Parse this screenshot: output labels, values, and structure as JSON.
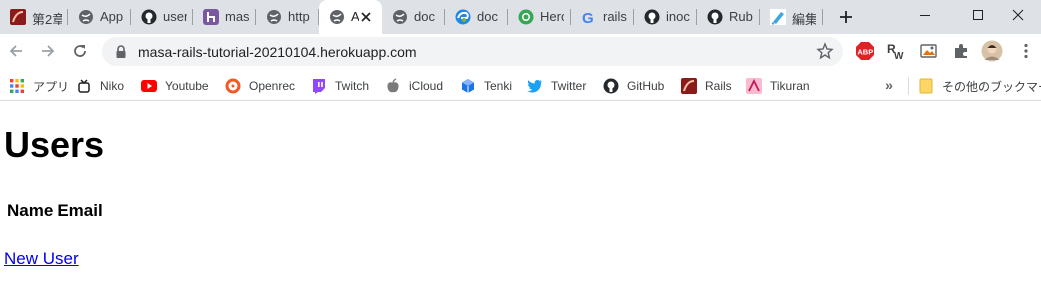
{
  "browser": {
    "tabs": [
      {
        "title": "第2章",
        "icon": "rails-logo-icon"
      },
      {
        "title": "App",
        "icon": "globe-icon"
      },
      {
        "title": "user",
        "icon": "github-icon"
      },
      {
        "title": "mas",
        "icon": "heroku-icon"
      },
      {
        "title": "http",
        "icon": "globe-icon"
      },
      {
        "title": "A",
        "icon": "globe-icon"
      },
      {
        "title": "doc",
        "icon": "globe-icon"
      },
      {
        "title": "doc",
        "icon": "edge-icon"
      },
      {
        "title": "Hero",
        "icon": "green-circle-icon"
      },
      {
        "title": "rails",
        "icon": "google-icon"
      },
      {
        "title": "inoc",
        "icon": "github-icon"
      },
      {
        "title": "Rub",
        "icon": "github-icon"
      },
      {
        "title": "編集",
        "icon": "pencil-icon"
      }
    ],
    "active_tab_index": 5,
    "url": "masa-rails-tutorial-20210104.herokuapp.com",
    "bookmarks": [
      {
        "label": "アプリ",
        "icon": "apps-grid-icon"
      },
      {
        "label": "Niko",
        "icon": "niko-icon"
      },
      {
        "label": "Youtube",
        "icon": "youtube-icon"
      },
      {
        "label": "Openrec",
        "icon": "openrec-icon"
      },
      {
        "label": "Twitch",
        "icon": "twitch-icon"
      },
      {
        "label": "iCloud",
        "icon": "apple-icon"
      },
      {
        "label": "Tenki",
        "icon": "tenki-icon"
      },
      {
        "label": "Twitter",
        "icon": "twitter-icon"
      },
      {
        "label": "GitHub",
        "icon": "github-icon"
      },
      {
        "label": "Rails",
        "icon": "rails-logo-icon"
      },
      {
        "label": "Tikuran",
        "icon": "tikuran-icon"
      }
    ],
    "more_bookmarks_glyph": "»",
    "other_bookmarks": "その他のブックマーク",
    "extensions": [
      "adblock-icon",
      "rw-extension-icon",
      "image-extension-icon",
      "puzzle-icon",
      "profile-avatar"
    ],
    "colors": {
      "tabstrip": "#dee1e6",
      "omnibox": "#f1f3f4",
      "link": "#0000ee"
    }
  },
  "page": {
    "title": "Users",
    "table_headers": [
      "Name",
      "Email"
    ],
    "new_user_link": "New User"
  }
}
